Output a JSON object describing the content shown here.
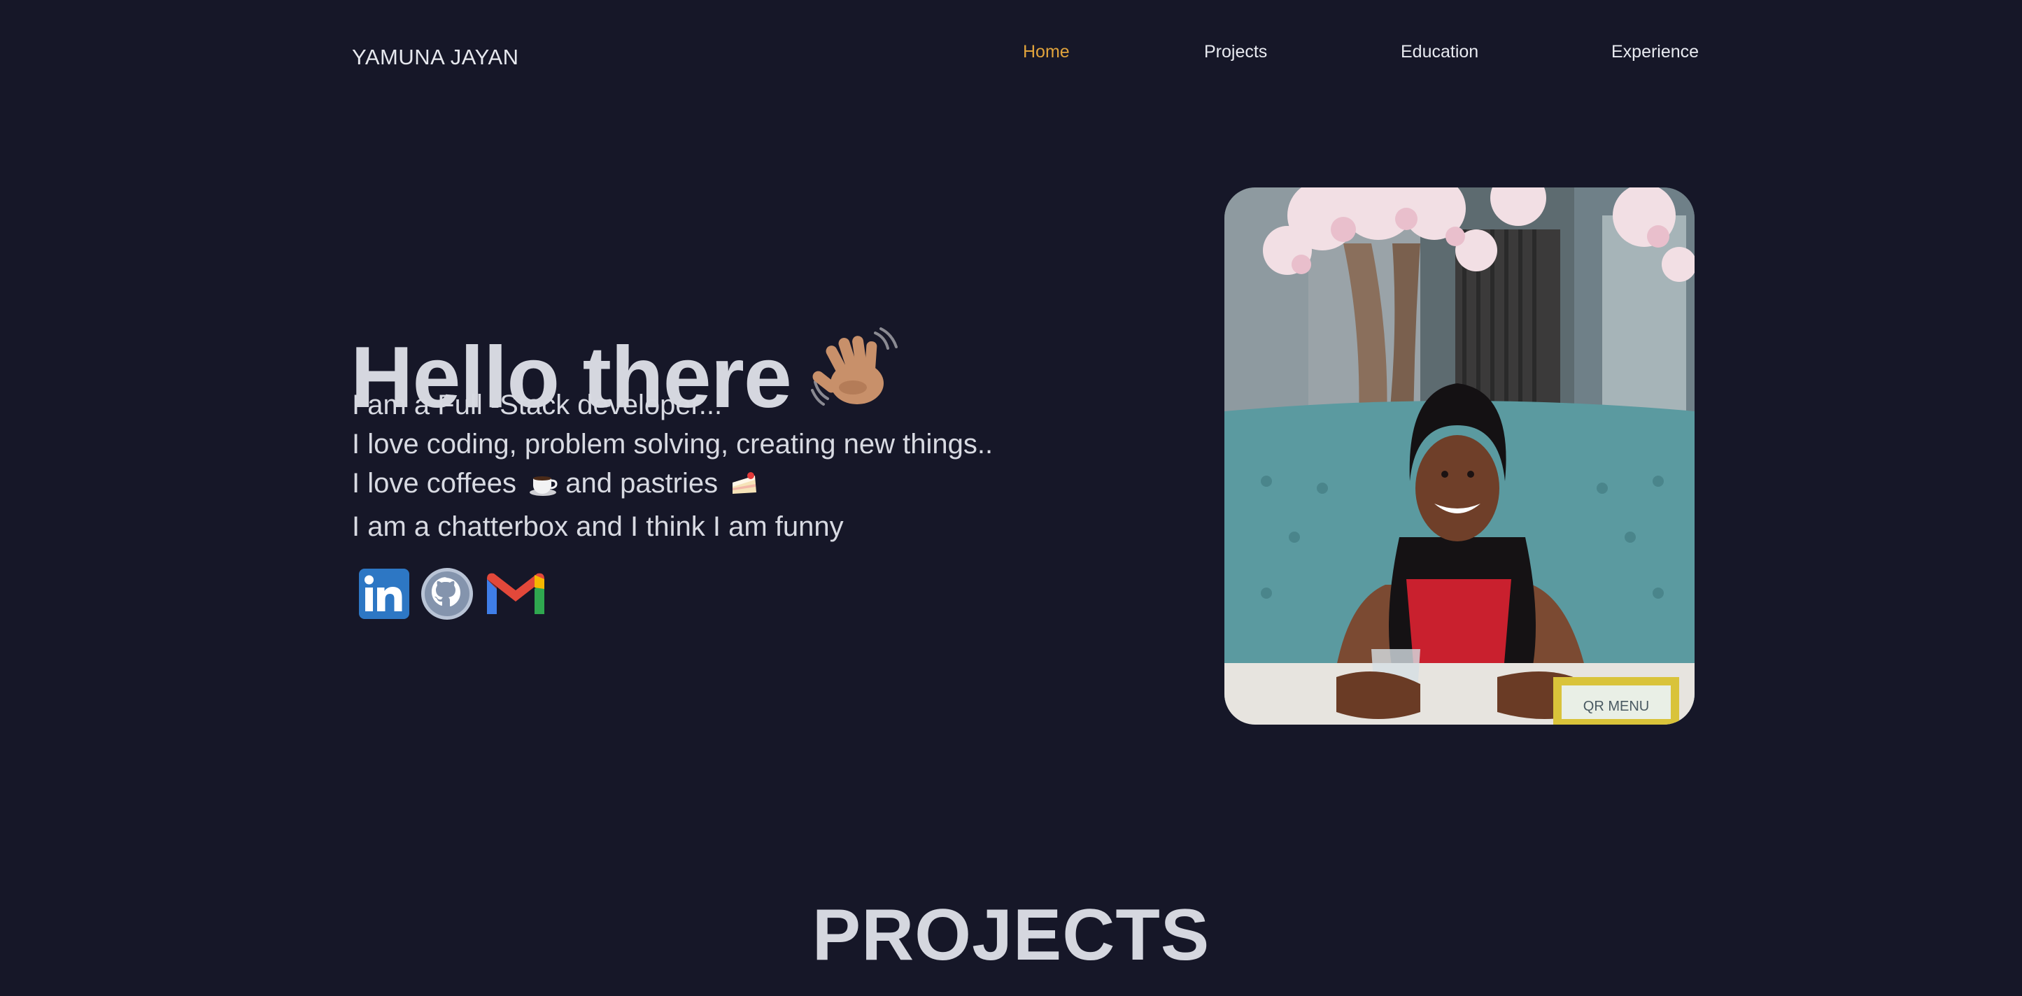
{
  "header": {
    "brand": "YAMUNA JAYAN",
    "nav": [
      {
        "label": "Home",
        "active": true
      },
      {
        "label": "Projects",
        "active": false
      },
      {
        "label": "Education",
        "active": false
      },
      {
        "label": "Experience",
        "active": false
      }
    ]
  },
  "hero": {
    "title": "Hello there",
    "title_icon": "waving-hand-icon",
    "lines": [
      "I am a Full -Stack developer...",
      "I love coding, problem solving, creating new things..",
      "I love coffees",
      "and pastries",
      "I am a chatterbox and I think I am funny"
    ],
    "line_icons": [
      "coffee-cup-icon",
      "cake-slice-icon"
    ],
    "socials": [
      "linkedin-icon",
      "github-icon",
      "gmail-icon"
    ],
    "photo": "profile-photo"
  },
  "sections": {
    "projects_heading": "PROJECTS"
  },
  "colors": {
    "background": "#161728",
    "accent": "#e0a33c",
    "text": "#d6d8e0"
  }
}
